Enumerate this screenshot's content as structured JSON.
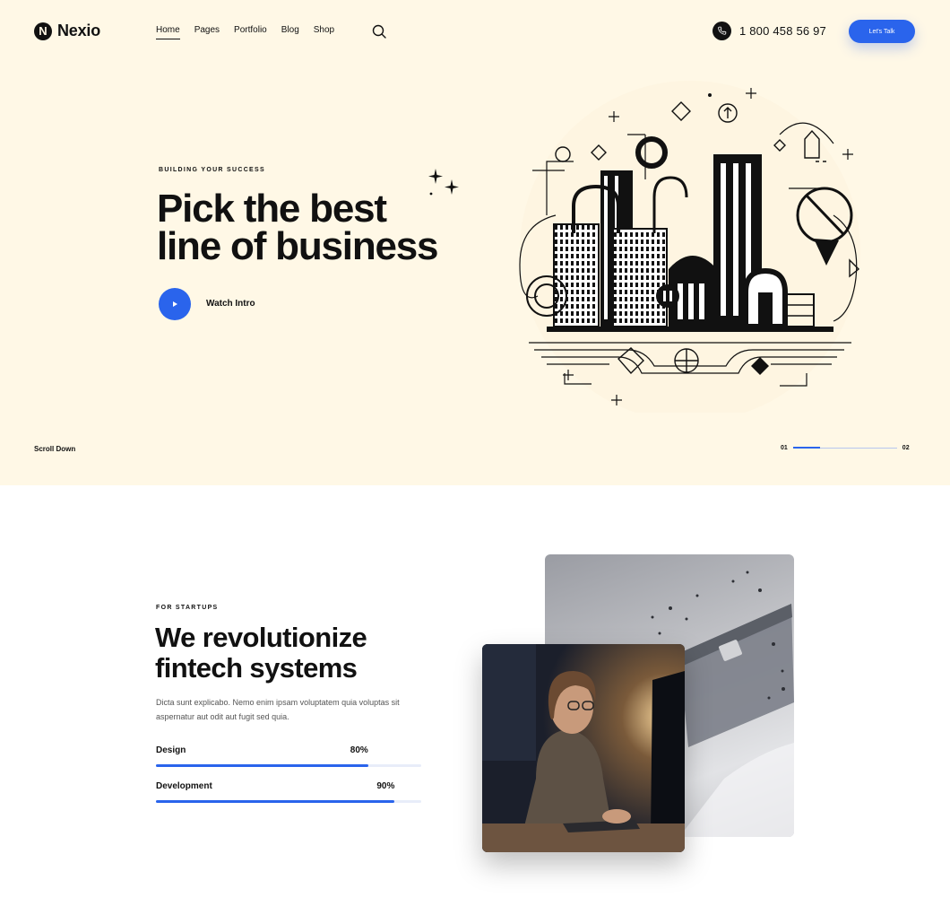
{
  "brand": {
    "logo_letter": "N",
    "name": "Nexio"
  },
  "nav": {
    "items": [
      {
        "label": "Home",
        "active": true
      },
      {
        "label": "Pages",
        "active": false
      },
      {
        "label": "Portfolio",
        "active": false
      },
      {
        "label": "Blog",
        "active": false
      },
      {
        "label": "Shop",
        "active": false
      }
    ]
  },
  "header": {
    "phone": "1 800 458 56 97",
    "cta_label": "Let's Talk"
  },
  "hero": {
    "eyebrow": "BUILDING YOUR SUCCESS",
    "title_line1": "Pick the best",
    "title_line2": "line of business",
    "play_label": "Watch Intro",
    "scroll_label": "Scroll Down",
    "slide_current": "01",
    "slide_total": "02",
    "slide_progress": 0.26
  },
  "section2": {
    "eyebrow": "FOR STARTUPS",
    "title_line1": "We revolutionize",
    "title_line2": "fintech systems",
    "description": "Dicta sunt explicabo. Nemo enim ipsam voluptatem quia voluptas sit aspernatur aut odit aut fugit sed quia.",
    "skills": [
      {
        "label": "Design",
        "value_text": "80%",
        "value": 80
      },
      {
        "label": "Development",
        "value_text": "90%",
        "value": 90
      }
    ]
  },
  "colors": {
    "accent": "#2a64ec",
    "hero_bg": "#fff8e6",
    "text": "#111111"
  },
  "icons": {
    "search": "search-icon",
    "phone": "phone-icon",
    "play": "play-icon",
    "sparkle": "sparkle-icon"
  }
}
